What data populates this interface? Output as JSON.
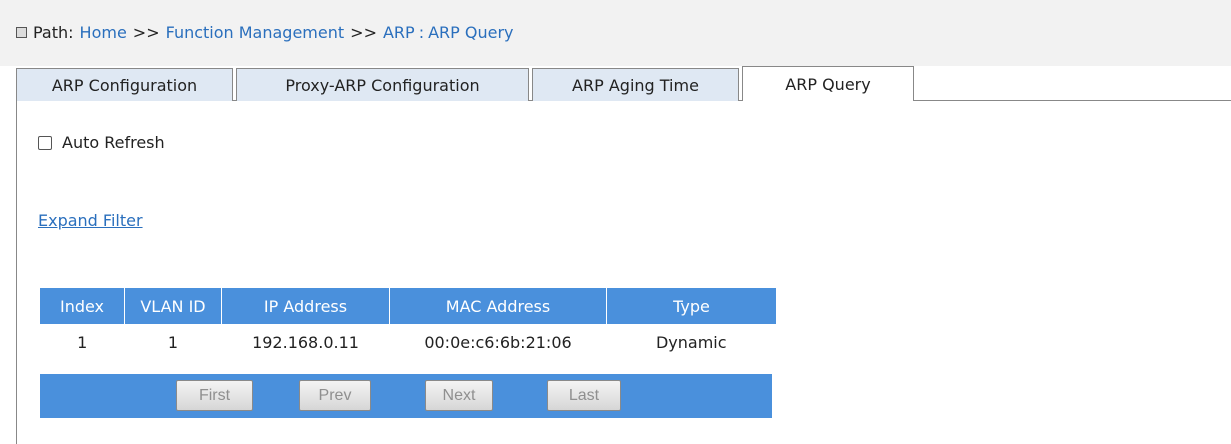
{
  "breadcrumb": {
    "label": "Path:",
    "items": [
      "Home",
      "Function Management",
      "ARP",
      "ARP Query"
    ],
    "separator": ">>",
    "last_separator": ":"
  },
  "tabs": [
    {
      "label": "ARP Configuration",
      "active": false
    },
    {
      "label": "Proxy-ARP Configuration",
      "active": false
    },
    {
      "label": "ARP Aging Time",
      "active": false
    },
    {
      "label": "ARP Query",
      "active": true
    }
  ],
  "auto_refresh": {
    "label": "Auto Refresh",
    "checked": false
  },
  "expand_filter": "Expand Filter",
  "table": {
    "headers": [
      "Index",
      "VLAN ID",
      "IP Address",
      "MAC Address",
      "Type"
    ],
    "rows": [
      [
        "1",
        "1",
        "192.168.0.11",
        "00:0e:c6:6b:21:06",
        "Dynamic"
      ]
    ]
  },
  "pager": {
    "first": "First",
    "prev": "Prev",
    "next": "Next",
    "last": "Last"
  },
  "colors": {
    "header_blue": "#4a90dc",
    "link_blue": "#2a6fbd",
    "tab_bg": "#dfe8f3"
  }
}
